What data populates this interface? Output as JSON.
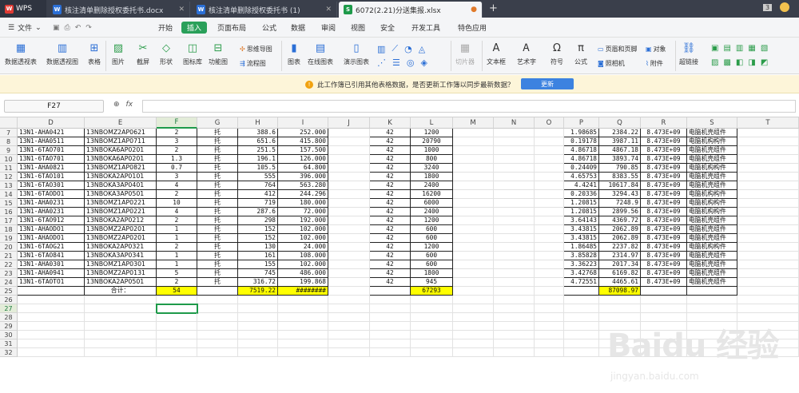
{
  "titlebar": {
    "app": "WPS",
    "tabs": [
      {
        "label": "核注清单删除授权委托书.docx",
        "icon": "W",
        "color": "#2b6fd6",
        "active": false
      },
      {
        "label": "核注清单删除授权委托书 (1)",
        "icon": "W",
        "color": "#2b6fd6",
        "active": false
      },
      {
        "label": "6072(2.21)分送集报.xlsx",
        "icon": "S",
        "color": "#1e9a4a",
        "active": true
      }
    ],
    "badge": "3"
  },
  "menu": {
    "file": "文件",
    "items": [
      "开始",
      "插入",
      "页面布局",
      "公式",
      "数据",
      "审阅",
      "视图",
      "安全",
      "开发工具",
      "特色应用"
    ],
    "active": "插入"
  },
  "ribbon": {
    "big": [
      "数据透视表",
      "数据透视图",
      "表格",
      "图片",
      "截屏",
      "形状",
      "图标库",
      "功能图",
      "流程图",
      "图表",
      "在线图表",
      "演示图表",
      "切片器",
      "文本框",
      "艺术字",
      "符号",
      "公式",
      "超链接"
    ],
    "small": [
      "思维导图",
      "流程图",
      "页眉和页脚",
      "照相机",
      "对象",
      "附件"
    ]
  },
  "notice": {
    "text": "此工作簿已引用其他表格数据，是否更新工作簿以同步最新数据？",
    "button": "更新"
  },
  "formula": {
    "namebox": "F27",
    "fx": "fx",
    "value": ""
  },
  "sheet": {
    "columns": [
      "D",
      "E",
      "F",
      "G",
      "H",
      "I",
      "J",
      "K",
      "L",
      "M",
      "N",
      "O",
      "P",
      "Q",
      "R",
      "S",
      "T"
    ],
    "selected_column": "F",
    "selected_row": "27",
    "rows": [
      {
        "n": "7",
        "D": "13N1-AHA0421",
        "E": "13NBOMZ2AP0621",
        "F": "2",
        "G": "托",
        "H": "388.6",
        "I": "252.000",
        "K": "42",
        "L": "1200",
        "P": "1.98685",
        "Q": "2384.22",
        "R": "8.473E+09",
        "S": "电脑机壳组件"
      },
      {
        "n": "8",
        "D": "13N1-AHA0511",
        "E": "13NBOMZ1AP0711",
        "F": "3",
        "G": "托",
        "H": "651.6",
        "I": "415.800",
        "K": "42",
        "L": "20790",
        "P": "0.19178",
        "Q": "3987.11",
        "R": "8.473E+09",
        "S": "电脑机构构件"
      },
      {
        "n": "9",
        "D": "13N1-6TAO701",
        "E": "13NBOKA6AP0201",
        "F": "2",
        "G": "托",
        "H": "251.5",
        "I": "157.500",
        "K": "42",
        "L": "1000",
        "P": "4.86718",
        "Q": "4867.18",
        "R": "8.473E+09",
        "S": "电脑机壳组件"
      },
      {
        "n": "10",
        "D": "13N1-6TAO701",
        "E": "13NBOKA6AP0201",
        "F": "1.3",
        "G": "托",
        "H": "196.1",
        "I": "126.000",
        "K": "42",
        "L": "800",
        "P": "4.86718",
        "Q": "3893.74",
        "R": "8.473E+09",
        "S": "电脑机壳组件"
      },
      {
        "n": "11",
        "D": "13N1-AHA0821",
        "E": "13NBOMZ1AP0821",
        "F": "0.7",
        "G": "托",
        "H": "105.5",
        "I": "64.800",
        "K": "42",
        "L": "3240",
        "P": "0.24409",
        "Q": "790.85",
        "R": "8.473E+09",
        "S": "电脑机构构件"
      },
      {
        "n": "12",
        "D": "13N1-6TAO101",
        "E": "13NBOKA2AP0101",
        "F": "3",
        "G": "托",
        "H": "555",
        "I": "396.000",
        "K": "42",
        "L": "1800",
        "P": "4.65753",
        "Q": "8383.55",
        "R": "8.473E+09",
        "S": "电脑机壳组件"
      },
      {
        "n": "13",
        "D": "13N1-6TAO301",
        "E": "13NBOKA3AP0401",
        "F": "4",
        "G": "托",
        "H": "764",
        "I": "563.280",
        "K": "42",
        "L": "2400",
        "P": "4.4241",
        "Q": "10617.84",
        "R": "8.473E+09",
        "S": "电脑机壳组件"
      },
      {
        "n": "14",
        "D": "13N1-6TAODO1",
        "E": "13NBOKA3AP0501",
        "F": "2",
        "G": "托",
        "H": "412",
        "I": "244.296",
        "K": "42",
        "L": "16200",
        "P": "0.20336",
        "Q": "3294.43",
        "R": "8.473E+09",
        "S": "电脑机构构件"
      },
      {
        "n": "15",
        "D": "13N1-AHA0231",
        "E": "13NBOMZ1AP0221",
        "F": "10",
        "G": "托",
        "H": "719",
        "I": "180.000",
        "K": "42",
        "L": "6000",
        "P": "1.20815",
        "Q": "7248.9",
        "R": "8.473E+09",
        "S": "电脑机构构件"
      },
      {
        "n": "16",
        "D": "13N1-AHA0231",
        "E": "13NBOMZ1AP0221",
        "F": "4",
        "G": "托",
        "H": "287.6",
        "I": "72.000",
        "K": "42",
        "L": "2400",
        "P": "1.20815",
        "Q": "2899.56",
        "R": "8.473E+09",
        "S": "电脑机构构件"
      },
      {
        "n": "17",
        "D": "13N1-6TAO912",
        "E": "13NBOKA2AP0212",
        "F": "2",
        "G": "托",
        "H": "298",
        "I": "192.000",
        "K": "42",
        "L": "1200",
        "P": "3.64143",
        "Q": "4369.72",
        "R": "8.473E+09",
        "S": "电脑机壳组件"
      },
      {
        "n": "18",
        "D": "13N1-AHAODO1",
        "E": "13NBOMZ2AP0201",
        "F": "1",
        "G": "托",
        "H": "152",
        "I": "102.000",
        "K": "42",
        "L": "600",
        "P": "3.43815",
        "Q": "2062.89",
        "R": "8.473E+09",
        "S": "电脑机壳组件"
      },
      {
        "n": "19",
        "D": "13N1-AHAODO1",
        "E": "13NBOMZ2AP0201",
        "F": "1",
        "G": "托",
        "H": "152",
        "I": "102.000",
        "K": "42",
        "L": "600",
        "P": "3.43815",
        "Q": "2062.89",
        "R": "8.473E+09",
        "S": "电脑机壳组件"
      },
      {
        "n": "20",
        "D": "13N1-6TAOG21",
        "E": "13NBOKA2AP0321",
        "F": "2",
        "G": "托",
        "H": "130",
        "I": "24.000",
        "K": "42",
        "L": "1200",
        "P": "1.86485",
        "Q": "2237.82",
        "R": "8.473E+09",
        "S": "电脑机构构件"
      },
      {
        "n": "21",
        "D": "13N1-6TAO841",
        "E": "13NBOKA3AP0341",
        "F": "1",
        "G": "托",
        "H": "161",
        "I": "108.000",
        "K": "42",
        "L": "600",
        "P": "3.85828",
        "Q": "2314.97",
        "R": "8.473E+09",
        "S": "电脑机壳组件"
      },
      {
        "n": "22",
        "D": "13N1-AHA0301",
        "E": "13NBOMZ1AP0301",
        "F": "1",
        "G": "托",
        "H": "155",
        "I": "102.000",
        "K": "42",
        "L": "600",
        "P": "3.36223",
        "Q": "2017.34",
        "R": "8.473E+09",
        "S": "电脑机壳组件"
      },
      {
        "n": "23",
        "D": "13N1-AHA0941",
        "E": "13NBOMZ2AP0131",
        "F": "5",
        "G": "托",
        "H": "745",
        "I": "486.000",
        "K": "42",
        "L": "1800",
        "P": "3.42768",
        "Q": "6169.82",
        "R": "8.473E+09",
        "S": "电脑机壳组件"
      },
      {
        "n": "24",
        "D": "13N1-6TAOTO1",
        "E": "13NBOKA2AP0501",
        "F": "2",
        "G": "托",
        "H": "316.72",
        "I": "199.868",
        "K": "42",
        "L": "945",
        "P": "4.72551",
        "Q": "4465.61",
        "R": "8.473E+09",
        "S": "电脑机壳组件"
      }
    ],
    "total": {
      "n": "25",
      "E": "合计：",
      "F": "54",
      "H": "7519.22",
      "I": "########",
      "L": "67293",
      "Q": "87098.97"
    },
    "empty_rows": [
      "26",
      "27",
      "28",
      "29",
      "30",
      "31",
      "32"
    ]
  },
  "watermark": {
    "main": "Baidu 经验",
    "sub": "jingyan.baidu.com"
  }
}
